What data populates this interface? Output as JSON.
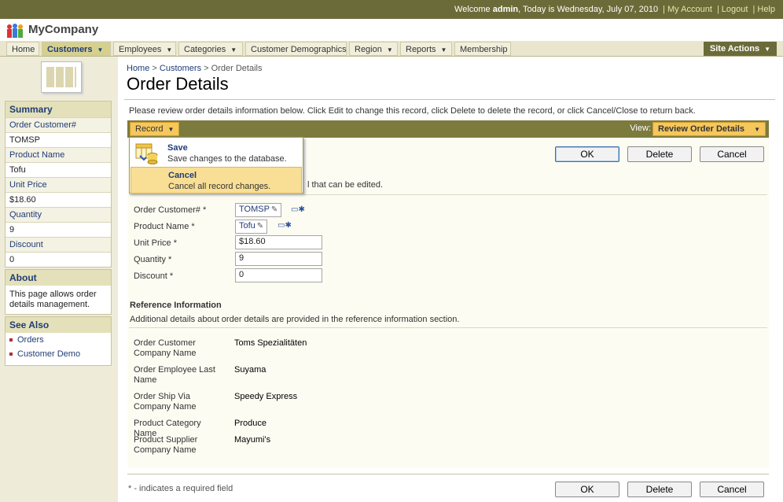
{
  "topbar": {
    "welcome_prefix": "Welcome ",
    "user": "admin",
    "date_text": ", Today is Wednesday, July 07, 2010",
    "links": [
      "My Account",
      "Logout",
      "Help"
    ]
  },
  "app": {
    "name": "MyCompany"
  },
  "menu": {
    "items": [
      {
        "label": "Home"
      },
      {
        "label": "Customers"
      },
      {
        "label": "Employees"
      },
      {
        "label": "Categories"
      },
      {
        "label": "Customer Demographics"
      },
      {
        "label": "Region"
      },
      {
        "label": "Reports"
      },
      {
        "label": "Membership"
      }
    ],
    "site_actions": "Site Actions"
  },
  "sidebar": {
    "summary_title": "Summary",
    "fields": [
      {
        "label": "Order Customer#",
        "value": "TOMSP"
      },
      {
        "label": "Product Name",
        "value": "Tofu"
      },
      {
        "label": "Unit Price",
        "value": "$18.60"
      },
      {
        "label": "Quantity",
        "value": "9"
      },
      {
        "label": "Discount",
        "value": "0"
      }
    ],
    "about_title": "About",
    "about_text": "This page allows order details management.",
    "see_also_title": "See Also",
    "see_also": [
      "Orders",
      "Customer Demo"
    ]
  },
  "breadcrumb": {
    "home": "Home",
    "customers": "Customers",
    "current": "Order Details",
    "sep": ">"
  },
  "page": {
    "title": "Order Details",
    "intro": "Please review order details information below. Click Edit to change this record, click Delete to delete the record, or click Cancel/Close to return back."
  },
  "actionbar": {
    "record": "Record",
    "view_label": "View:",
    "view_value": "Review Order Details"
  },
  "buttons": {
    "ok": "OK",
    "delete": "Delete",
    "cancel": "Cancel"
  },
  "dropdown": {
    "items": [
      {
        "title": "Save",
        "desc": "Save changes to the database."
      },
      {
        "title": "Cancel",
        "desc": "Cancel all record changes."
      }
    ]
  },
  "form": {
    "section_desc_visible": "l that can be edited.",
    "fields": [
      {
        "label": "Order Customer# *",
        "value": "TOMSP"
      },
      {
        "label": "Product Name *",
        "value": "Tofu"
      },
      {
        "label": "Unit Price *",
        "value": "$18.60"
      },
      {
        "label": "Quantity *",
        "value": "9"
      },
      {
        "label": "Discount *",
        "value": "0"
      }
    ]
  },
  "reference": {
    "title": "Reference Information",
    "desc": "Additional details about order details are provided in the reference information section.",
    "rows": [
      {
        "label": "Order Customer Company Name",
        "value": "Toms Spezialitäten"
      },
      {
        "label": "Order Employee Last Name",
        "value": "Suyama"
      },
      {
        "label": "Order Ship Via Company Name",
        "value": "Speedy Express"
      },
      {
        "label": "Product Category Name",
        "value": "Produce"
      },
      {
        "label": "Product Supplier Company Name",
        "value": "Mayumi's"
      }
    ]
  },
  "footnote": "* - indicates a required field"
}
